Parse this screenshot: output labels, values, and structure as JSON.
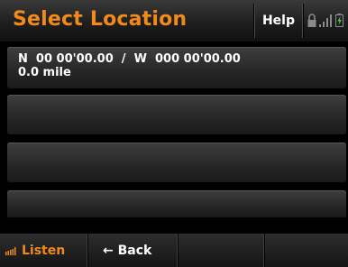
{
  "header": {
    "title": "Select Location",
    "help_label": "Help",
    "status_icons": [
      "lock-icon",
      "signal-bars-icon",
      "battery-icon"
    ]
  },
  "location": {
    "coordinates": "N  00 00'00.00  /  W  000 00'00.00",
    "distance": "0.0 mile"
  },
  "footer": {
    "listen_label": "Listen",
    "back_label": "← Back",
    "listen_icon": "speaker-bars-icon"
  },
  "colors": {
    "accent": "#f08a1c",
    "background": "#000000",
    "text": "#ffffff"
  }
}
